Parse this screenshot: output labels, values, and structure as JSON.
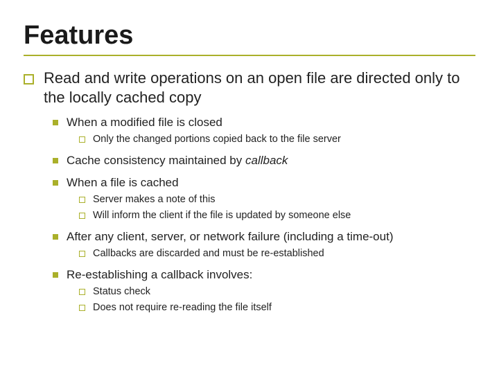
{
  "title": "Features",
  "lvl1": "Read and write operations on an open file are directed only to the locally cached copy",
  "items": [
    {
      "text": "When a modified file is closed",
      "sub": [
        "Only the changed portions copied back to the file server"
      ]
    },
    {
      "text_prefix": "Cache consistency maintained by ",
      "text_italic": "callback",
      "sub": []
    },
    {
      "text": "When a file is cached",
      "sub": [
        "Server makes a note of this",
        "Will inform the client if the file is updated by someone else"
      ]
    },
    {
      "text": "After any client, server, or network failure (including a time-out)",
      "sub": [
        "Callbacks are discarded and must be re-established"
      ]
    },
    {
      "text": "Re-establishing a callback involves:",
      "sub": [
        "Status check",
        "Does not require re-reading the file itself"
      ]
    }
  ]
}
